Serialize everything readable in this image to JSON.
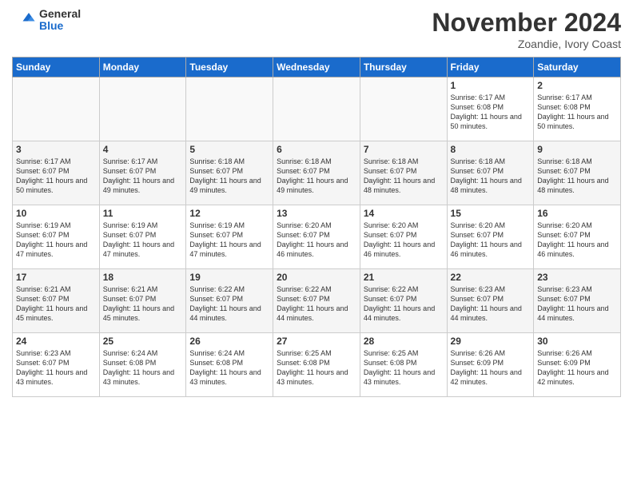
{
  "logo": {
    "general": "General",
    "blue": "Blue"
  },
  "header": {
    "title": "November 2024",
    "location": "Zoandie, Ivory Coast"
  },
  "days_of_week": [
    "Sunday",
    "Monday",
    "Tuesday",
    "Wednesday",
    "Thursday",
    "Friday",
    "Saturday"
  ],
  "weeks": [
    [
      {
        "day": "",
        "info": ""
      },
      {
        "day": "",
        "info": ""
      },
      {
        "day": "",
        "info": ""
      },
      {
        "day": "",
        "info": ""
      },
      {
        "day": "",
        "info": ""
      },
      {
        "day": "1",
        "info": "Sunrise: 6:17 AM\nSunset: 6:08 PM\nDaylight: 11 hours and 50 minutes."
      },
      {
        "day": "2",
        "info": "Sunrise: 6:17 AM\nSunset: 6:08 PM\nDaylight: 11 hours and 50 minutes."
      }
    ],
    [
      {
        "day": "3",
        "info": "Sunrise: 6:17 AM\nSunset: 6:07 PM\nDaylight: 11 hours and 50 minutes."
      },
      {
        "day": "4",
        "info": "Sunrise: 6:17 AM\nSunset: 6:07 PM\nDaylight: 11 hours and 49 minutes."
      },
      {
        "day": "5",
        "info": "Sunrise: 6:18 AM\nSunset: 6:07 PM\nDaylight: 11 hours and 49 minutes."
      },
      {
        "day": "6",
        "info": "Sunrise: 6:18 AM\nSunset: 6:07 PM\nDaylight: 11 hours and 49 minutes."
      },
      {
        "day": "7",
        "info": "Sunrise: 6:18 AM\nSunset: 6:07 PM\nDaylight: 11 hours and 48 minutes."
      },
      {
        "day": "8",
        "info": "Sunrise: 6:18 AM\nSunset: 6:07 PM\nDaylight: 11 hours and 48 minutes."
      },
      {
        "day": "9",
        "info": "Sunrise: 6:18 AM\nSunset: 6:07 PM\nDaylight: 11 hours and 48 minutes."
      }
    ],
    [
      {
        "day": "10",
        "info": "Sunrise: 6:19 AM\nSunset: 6:07 PM\nDaylight: 11 hours and 47 minutes."
      },
      {
        "day": "11",
        "info": "Sunrise: 6:19 AM\nSunset: 6:07 PM\nDaylight: 11 hours and 47 minutes."
      },
      {
        "day": "12",
        "info": "Sunrise: 6:19 AM\nSunset: 6:07 PM\nDaylight: 11 hours and 47 minutes."
      },
      {
        "day": "13",
        "info": "Sunrise: 6:20 AM\nSunset: 6:07 PM\nDaylight: 11 hours and 46 minutes."
      },
      {
        "day": "14",
        "info": "Sunrise: 6:20 AM\nSunset: 6:07 PM\nDaylight: 11 hours and 46 minutes."
      },
      {
        "day": "15",
        "info": "Sunrise: 6:20 AM\nSunset: 6:07 PM\nDaylight: 11 hours and 46 minutes."
      },
      {
        "day": "16",
        "info": "Sunrise: 6:20 AM\nSunset: 6:07 PM\nDaylight: 11 hours and 46 minutes."
      }
    ],
    [
      {
        "day": "17",
        "info": "Sunrise: 6:21 AM\nSunset: 6:07 PM\nDaylight: 11 hours and 45 minutes."
      },
      {
        "day": "18",
        "info": "Sunrise: 6:21 AM\nSunset: 6:07 PM\nDaylight: 11 hours and 45 minutes."
      },
      {
        "day": "19",
        "info": "Sunrise: 6:22 AM\nSunset: 6:07 PM\nDaylight: 11 hours and 44 minutes."
      },
      {
        "day": "20",
        "info": "Sunrise: 6:22 AM\nSunset: 6:07 PM\nDaylight: 11 hours and 44 minutes."
      },
      {
        "day": "21",
        "info": "Sunrise: 6:22 AM\nSunset: 6:07 PM\nDaylight: 11 hours and 44 minutes."
      },
      {
        "day": "22",
        "info": "Sunrise: 6:23 AM\nSunset: 6:07 PM\nDaylight: 11 hours and 44 minutes."
      },
      {
        "day": "23",
        "info": "Sunrise: 6:23 AM\nSunset: 6:07 PM\nDaylight: 11 hours and 44 minutes."
      }
    ],
    [
      {
        "day": "24",
        "info": "Sunrise: 6:23 AM\nSunset: 6:07 PM\nDaylight: 11 hours and 43 minutes."
      },
      {
        "day": "25",
        "info": "Sunrise: 6:24 AM\nSunset: 6:08 PM\nDaylight: 11 hours and 43 minutes."
      },
      {
        "day": "26",
        "info": "Sunrise: 6:24 AM\nSunset: 6:08 PM\nDaylight: 11 hours and 43 minutes."
      },
      {
        "day": "27",
        "info": "Sunrise: 6:25 AM\nSunset: 6:08 PM\nDaylight: 11 hours and 43 minutes."
      },
      {
        "day": "28",
        "info": "Sunrise: 6:25 AM\nSunset: 6:08 PM\nDaylight: 11 hours and 43 minutes."
      },
      {
        "day": "29",
        "info": "Sunrise: 6:26 AM\nSunset: 6:09 PM\nDaylight: 11 hours and 42 minutes."
      },
      {
        "day": "30",
        "info": "Sunrise: 6:26 AM\nSunset: 6:09 PM\nDaylight: 11 hours and 42 minutes."
      }
    ]
  ]
}
